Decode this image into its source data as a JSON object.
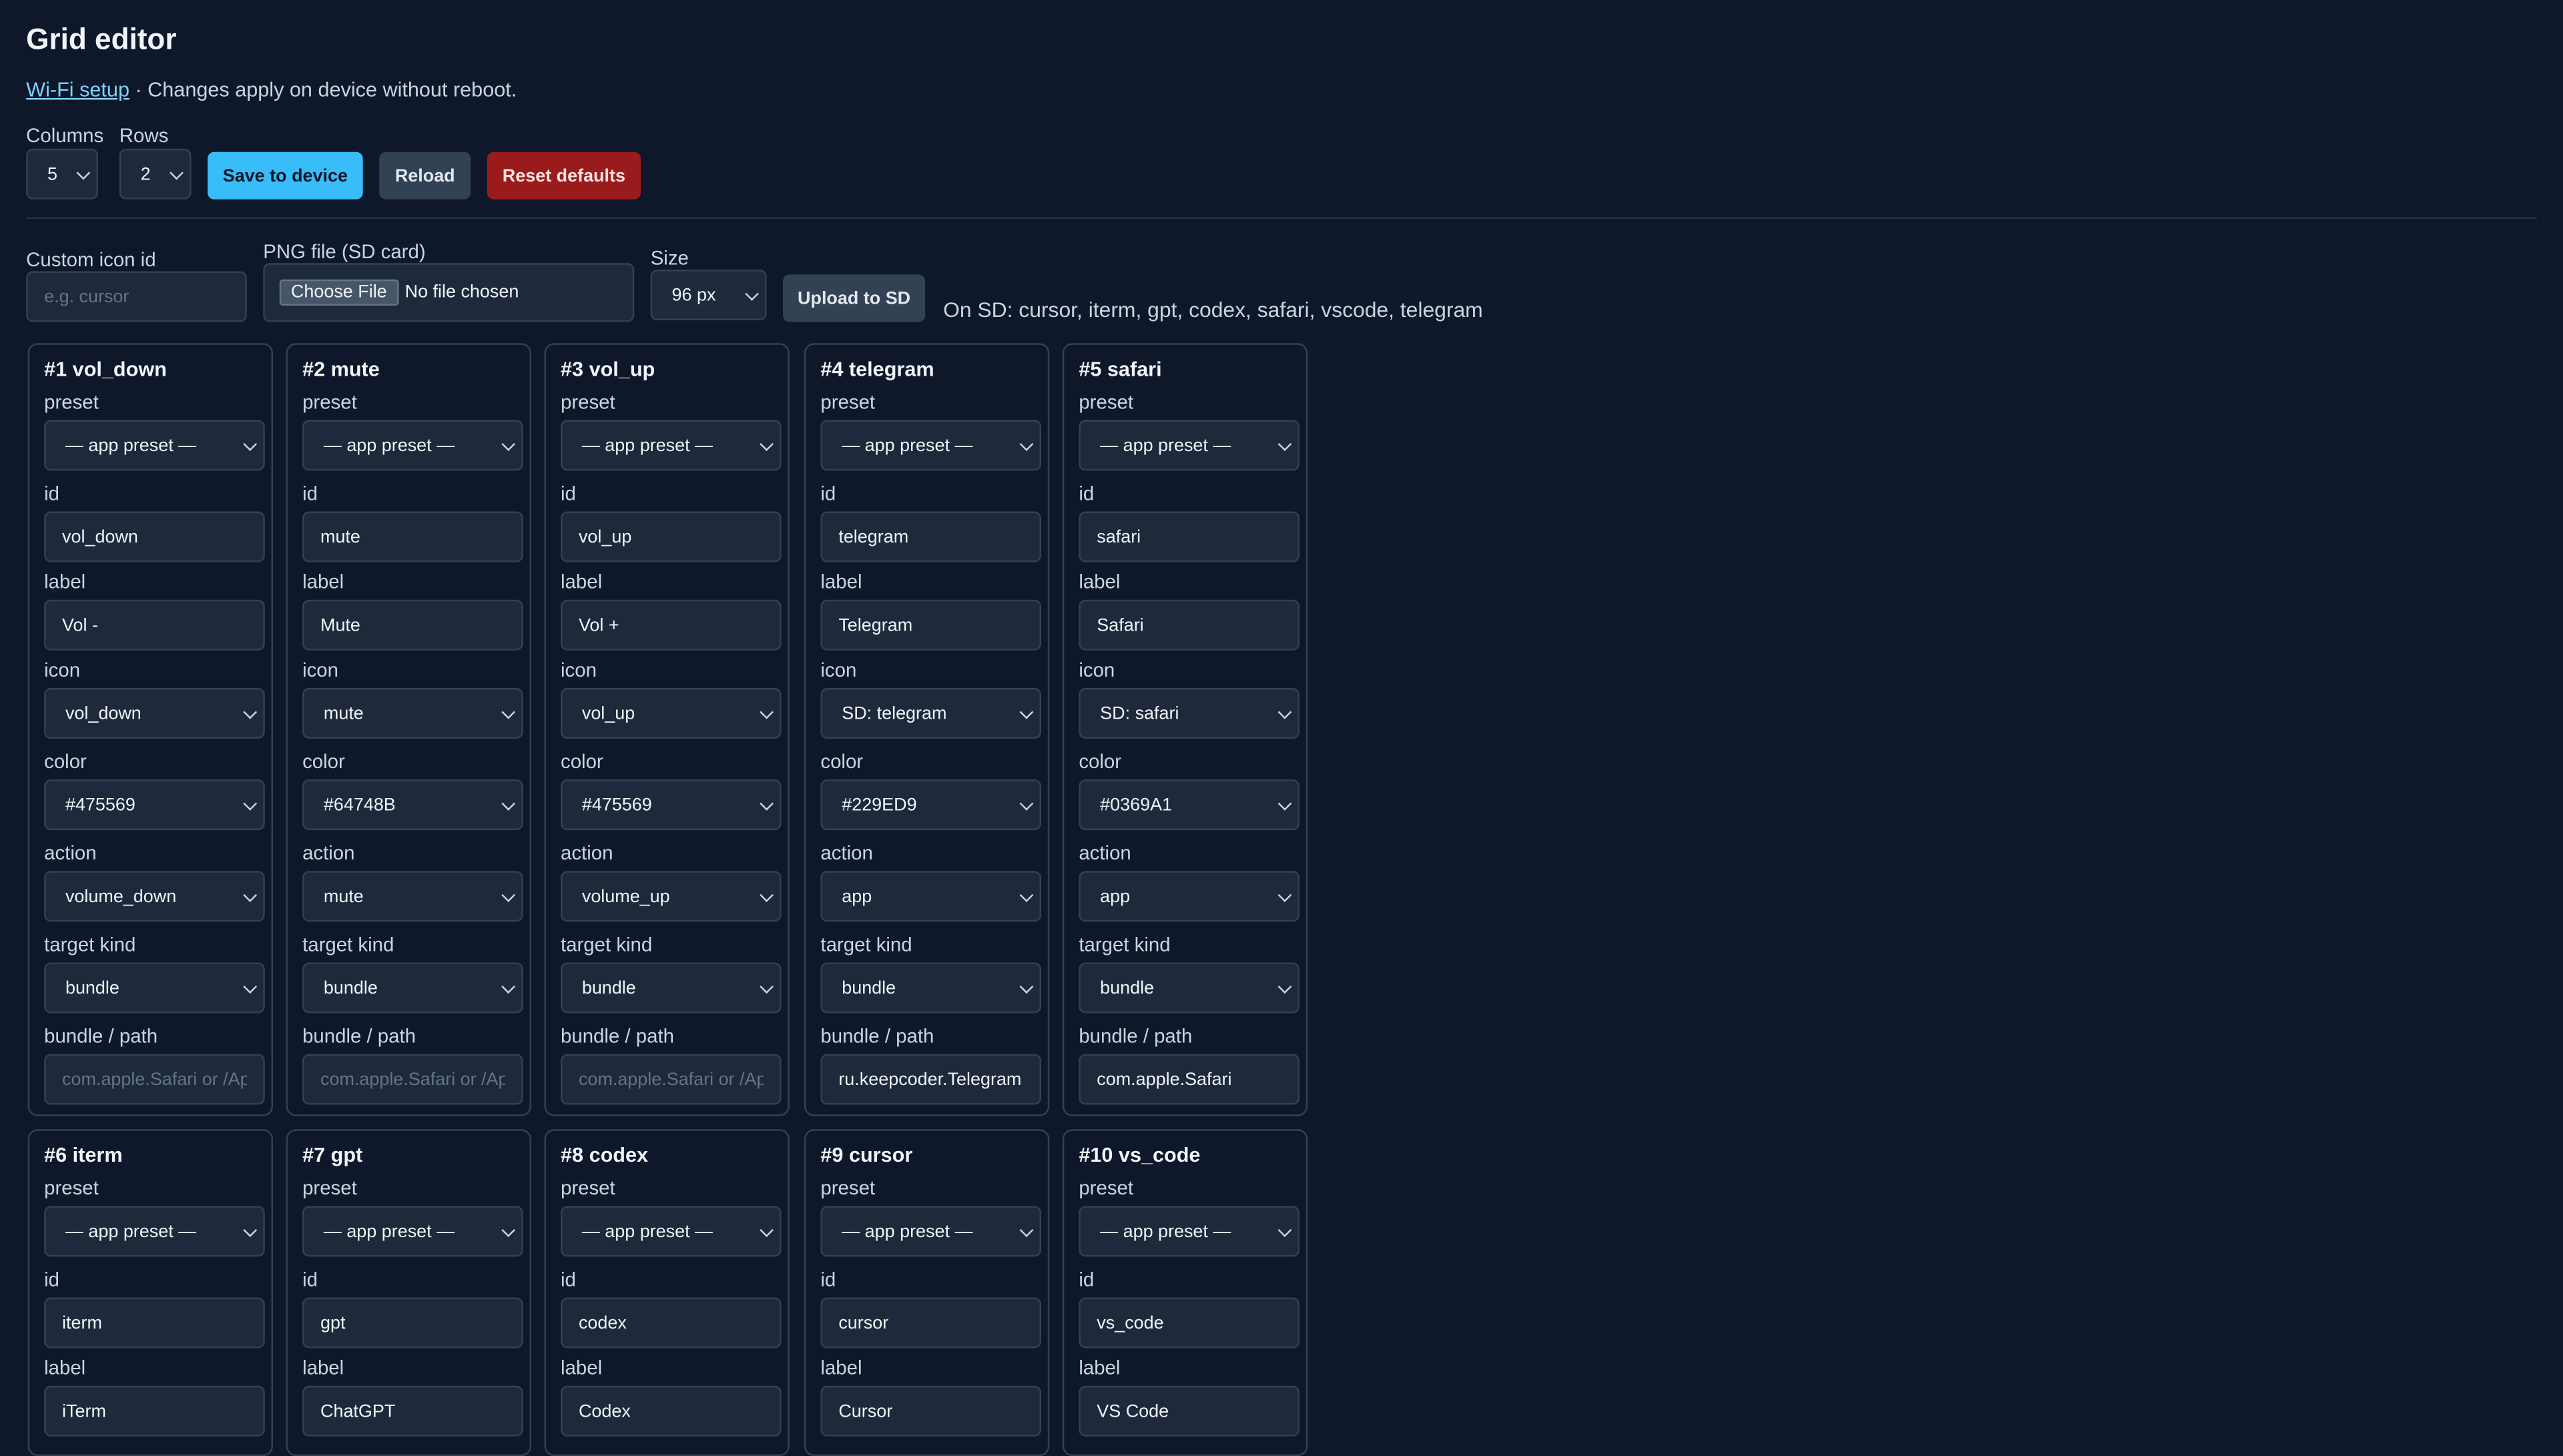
{
  "header": {
    "title": "Grid editor",
    "wifi_link": "Wi-Fi setup",
    "subtitle_rest": " · Changes apply on device without reboot."
  },
  "controls": {
    "columns_label": "Columns",
    "columns_value": "5",
    "rows_label": "Rows",
    "rows_value": "2",
    "save_label": "Save to device",
    "reload_label": "Reload",
    "reset_label": "Reset defaults"
  },
  "upload": {
    "custom_icon_label": "Custom icon id",
    "custom_icon_placeholder": "e.g. cursor",
    "png_label": "PNG file (SD card)",
    "choose_file_label": "Choose File",
    "no_file_text": "No file chosen",
    "size_label": "Size",
    "size_value": "96 px",
    "upload_label": "Upload to SD",
    "on_sd_text": "On SD: cursor, iterm, gpt, codex, safari, vscode, telegram"
  },
  "field_labels": {
    "preset": "preset",
    "id": "id",
    "label": "label",
    "icon": "icon",
    "color": "color",
    "action": "action",
    "target_kind": "target kind",
    "bundle_path": "bundle / path"
  },
  "bundle_placeholder": "com.apple.Safari or /Ap",
  "colors": {
    "accent": "#38bdf8",
    "danger": "#991b1b",
    "background": "#0f172a"
  },
  "cards": [
    {
      "title": "#1 vol_down",
      "preset": "— app preset —",
      "id": "vol_down",
      "label": "Vol -",
      "icon": "vol_down",
      "color": "#475569",
      "action": "volume_down",
      "target_kind": "bundle",
      "bundle": ""
    },
    {
      "title": "#2 mute",
      "preset": "— app preset —",
      "id": "mute",
      "label": "Mute",
      "icon": "mute",
      "color": "#64748B",
      "action": "mute",
      "target_kind": "bundle",
      "bundle": ""
    },
    {
      "title": "#3 vol_up",
      "preset": "— app preset —",
      "id": "vol_up",
      "label": "Vol +",
      "icon": "vol_up",
      "color": "#475569",
      "action": "volume_up",
      "target_kind": "bundle",
      "bundle": ""
    },
    {
      "title": "#4 telegram",
      "preset": "— app preset —",
      "id": "telegram",
      "label": "Telegram",
      "icon": "SD: telegram",
      "color": "#229ED9",
      "action": "app",
      "target_kind": "bundle",
      "bundle": "ru.keepcoder.Telegram"
    },
    {
      "title": "#5 safari",
      "preset": "— app preset —",
      "id": "safari",
      "label": "Safari",
      "icon": "SD: safari",
      "color": "#0369A1",
      "action": "app",
      "target_kind": "bundle",
      "bundle": "com.apple.Safari"
    },
    {
      "title": "#6 iterm",
      "preset": "— app preset —",
      "id": "iterm",
      "label": "iTerm"
    },
    {
      "title": "#7 gpt",
      "preset": "— app preset —",
      "id": "gpt",
      "label": "ChatGPT"
    },
    {
      "title": "#8 codex",
      "preset": "— app preset —",
      "id": "codex",
      "label": "Codex"
    },
    {
      "title": "#9 cursor",
      "preset": "— app preset —",
      "id": "cursor",
      "label": "Cursor"
    },
    {
      "title": "#10 vs_code",
      "preset": "— app preset —",
      "id": "vs_code",
      "label": "VS Code"
    }
  ]
}
